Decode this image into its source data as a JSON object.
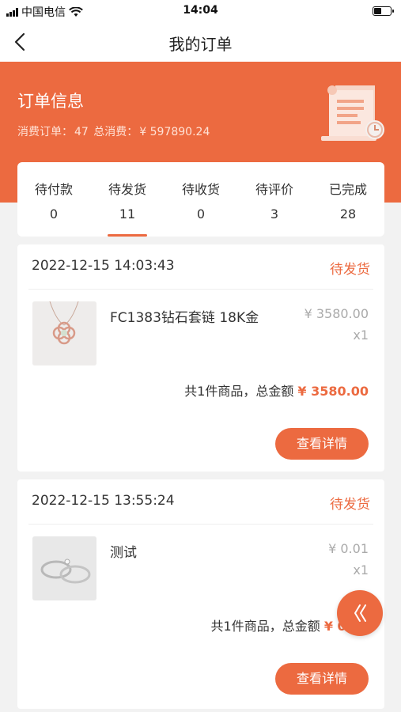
{
  "status_bar": {
    "carrier": "中国电信",
    "time": "14:04"
  },
  "nav": {
    "title": "我的订单"
  },
  "banner": {
    "title": "订单信息",
    "order_count_label": "消费订单：",
    "order_count": "47",
    "total_label": "总消费：",
    "total_amount": "¥ 597890.24"
  },
  "tabs": [
    {
      "label": "待付款",
      "count": "0"
    },
    {
      "label": "待发货",
      "count": "11",
      "active": true
    },
    {
      "label": "待收货",
      "count": "0"
    },
    {
      "label": "待评价",
      "count": "3"
    },
    {
      "label": "已完成",
      "count": "28"
    }
  ],
  "orders": [
    {
      "date": "2022-12-15 14:03:43",
      "status": "待发货",
      "product_name": "FC1383钻石套链 18K金",
      "price": "¥ 3580.00",
      "qty": "x1",
      "summary_text": "共1件商品，总金额",
      "total": "¥ 3580.00",
      "button": "查看详情"
    },
    {
      "date": "2022-12-15 13:55:24",
      "status": "待发货",
      "product_name": "测试",
      "price": "¥ 0.01",
      "qty": "x1",
      "summary_text": "共1件商品，总金额",
      "total": "¥ 0.01",
      "button": "查看详情"
    }
  ],
  "colors": {
    "accent": "#ec6a40",
    "page_bg": "#f2f2f2"
  },
  "icons": {
    "back": "chevron-left-icon",
    "float": "double-chevron-left-icon"
  }
}
